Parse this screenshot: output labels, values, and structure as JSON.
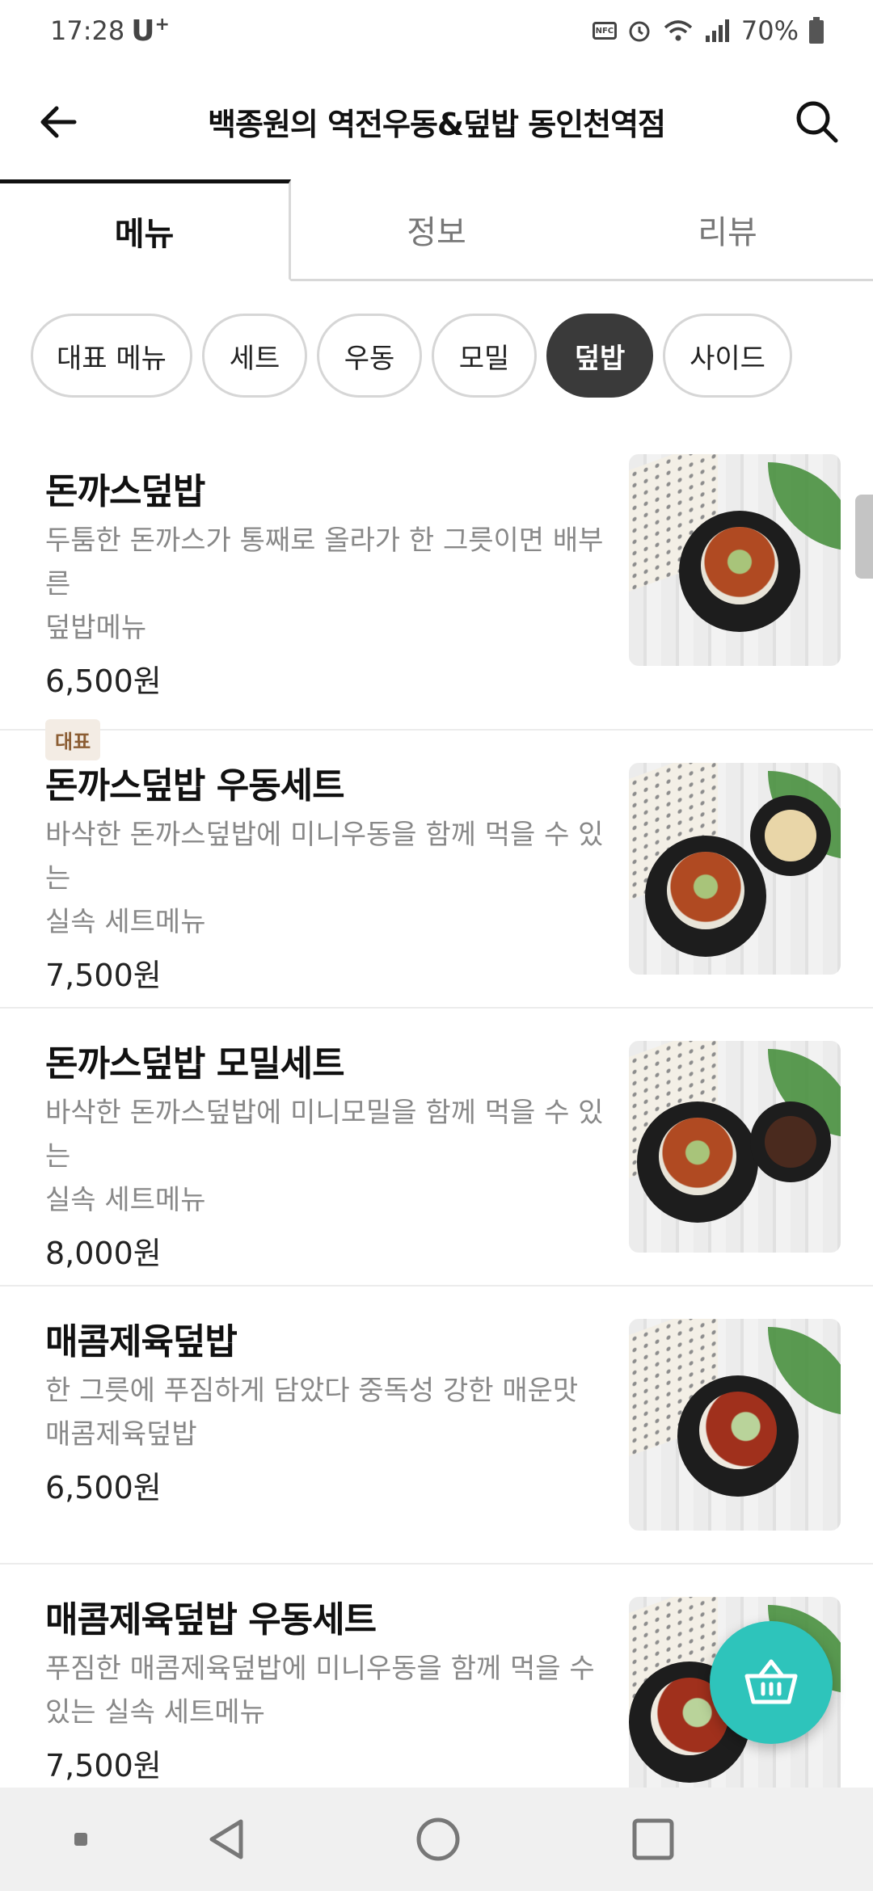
{
  "status_bar": {
    "time": "17:28",
    "carrier": "U",
    "carrier_sup": "+",
    "nfc": "NFC",
    "battery": "70%"
  },
  "header": {
    "title": "백종원의 역전우동&덮밥 동인천역점"
  },
  "tabs": [
    {
      "label": "메뉴",
      "active": true
    },
    {
      "label": "정보",
      "active": false
    },
    {
      "label": "리뷰",
      "active": false
    }
  ],
  "categories": [
    {
      "label": "대표 메뉴",
      "active": false
    },
    {
      "label": "세트",
      "active": false
    },
    {
      "label": "우동",
      "active": false
    },
    {
      "label": "모밀",
      "active": false
    },
    {
      "label": "덮밥",
      "active": true
    },
    {
      "label": "사이드",
      "active": false
    }
  ],
  "menu_items": [
    {
      "name": "돈까스덮밥",
      "desc_line1": "두툼한 돈까스가 통째로 올라가 한 그릇이면 배부른",
      "desc_line2": "덮밥메뉴",
      "price": "6,500원",
      "badge": "대표"
    },
    {
      "name": "돈까스덮밥 우동세트",
      "desc_line1": "바삭한 돈까스덮밥에 미니우동을 함께 먹을 수 있는",
      "desc_line2": "실속 세트메뉴",
      "price": "7,500원"
    },
    {
      "name": "돈까스덮밥 모밀세트",
      "desc_line1": "바삭한 돈까스덮밥에 미니모밀을 함께 먹을 수 있는",
      "desc_line2": "실속 세트메뉴",
      "price": "8,000원"
    },
    {
      "name": "매콤제육덮밥",
      "desc_line1": "한 그릇에 푸짐하게 담았다  중독성 강한 매운맛",
      "desc_line2": "매콤제육덮밥",
      "price": "6,500원"
    },
    {
      "name": "매콤제육덮밥 우동세트",
      "desc_line1": "푸짐한 매콤제육덮밥에 미니우동을 함께 먹을 수",
      "desc_line2": "있는 실속 세트메뉴",
      "price": "7,500원"
    }
  ],
  "icons": {
    "back": "arrow-left-icon",
    "search": "search-icon",
    "cart": "basket-icon",
    "nav_back": "triangle-back-icon",
    "nav_home": "circle-home-icon",
    "nav_recents": "square-recents-icon"
  },
  "colors": {
    "accent": "#2ec4bb",
    "chip_active": "#3a3a3a",
    "badge_bg": "#f3ece4",
    "badge_text": "#8b5d33"
  }
}
